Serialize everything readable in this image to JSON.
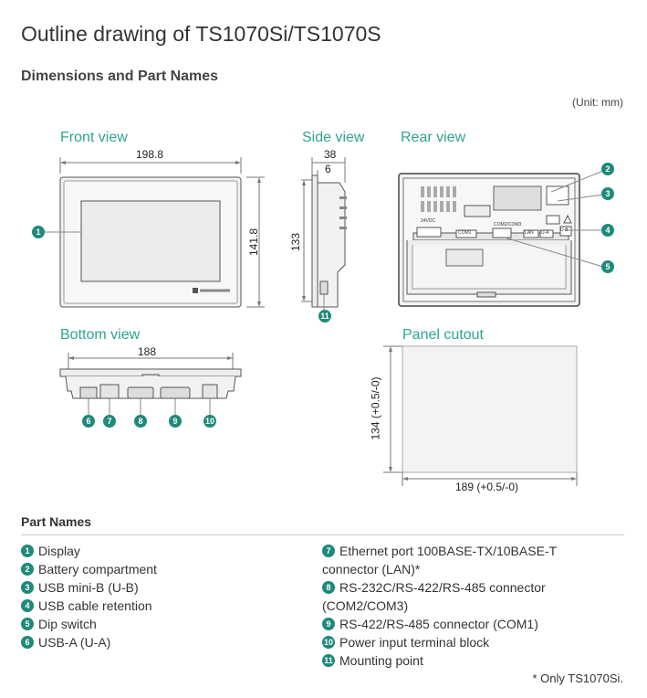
{
  "title": "Outline drawing of TS1070Si/TS1070S",
  "subtitle": "Dimensions and Part Names",
  "unit": "(Unit: mm)",
  "views": {
    "front": "Front view",
    "side": "Side view",
    "rear": "Rear view",
    "bottom": "Bottom view",
    "cutout": "Panel cutout"
  },
  "dims": {
    "front_width": "198.8",
    "front_height": "141.8",
    "side_depth": "38",
    "side_bezel": "6",
    "side_height": "133",
    "bottom_width": "188",
    "cutout_height": "134 (+0.5/-0)",
    "cutout_width": "189 (+0.5/-0)"
  },
  "rear_labels": {
    "dc": "24VDC",
    "com1": "COM1",
    "com23": "COM2/COM3",
    "lan": "LAN",
    "ua": "U-A",
    "ub": "U-B"
  },
  "part_names_heading": "Part Names",
  "parts_left": [
    {
      "num": "1",
      "text": "Display"
    },
    {
      "num": "2",
      "text": "Battery compartment"
    },
    {
      "num": "3",
      "text": "USB mini-B (U-B)"
    },
    {
      "num": "4",
      "text": "USB cable retention"
    },
    {
      "num": "5",
      "text": "Dip switch"
    },
    {
      "num": "6",
      "text": "USB-A (U-A)"
    }
  ],
  "parts_right": [
    {
      "num": "7",
      "text": "Ethernet port 100BASE-TX/10BASE-T connector (LAN)*"
    },
    {
      "num": "8",
      "text": "RS-232C/RS-422/RS-485 connector (COM2/COM3)"
    },
    {
      "num": "9",
      "text": "RS-422/RS-485 connector (COM1)"
    },
    {
      "num": "10",
      "text": "Power input terminal block"
    },
    {
      "num": "11",
      "text": "Mounting point"
    }
  ],
  "footnote": "* Only TS1070Si.",
  "colors": {
    "accent": "#2ea58f",
    "badge": "#1f8a7a"
  }
}
